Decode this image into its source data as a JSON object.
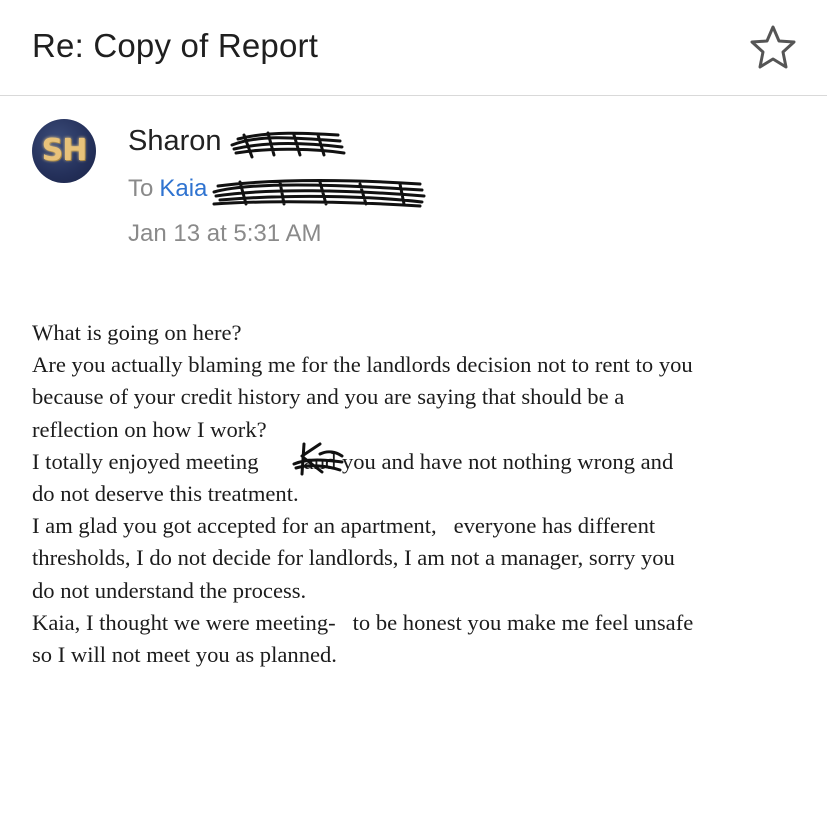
{
  "header": {
    "subject": "Re: Copy of Report",
    "star_icon": "star-outline-icon"
  },
  "message": {
    "avatar_initials": "SH",
    "sender_name": "Sharon",
    "to_label": "To",
    "recipient": "Kaia",
    "date": "Jan 13 at 5:31 AM"
  },
  "body": {
    "lines": [
      "What is going on here?",
      "Are you actually blaming me for the landlords decision not to rent to you",
      "because of your credit history and you are saying that should be a",
      "reflection on how I work?",
      "I totally enjoyed meeting        and you and have not nothing wrong and",
      "do not deserve this treatment.",
      "I am glad you got accepted for an apartment,   everyone has different",
      "thresholds, I do not decide for landlords, I am not a manager, sorry you",
      "do not understand the process.",
      "Kaia, I thought we were meeting-   to be honest you make me feel unsafe",
      "so I will not meet you as planned."
    ]
  },
  "colors": {
    "link": "#2f73d0",
    "meta_text": "#8a8a8a",
    "avatar_bg": "#24305a",
    "avatar_text": "#e8c27a"
  }
}
